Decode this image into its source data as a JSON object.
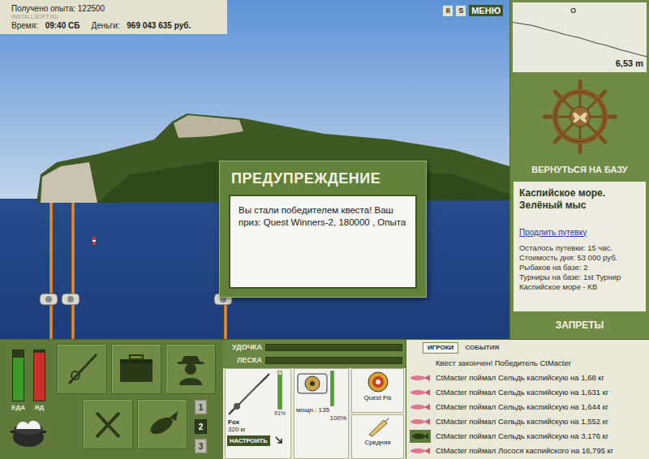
{
  "stats": {
    "experience_label": "Получено опыта:",
    "experience": "122500",
    "time_label": "Время:",
    "time": "09:40 СБ",
    "money_label": "Деньги:",
    "money": "969 043 635 руб."
  },
  "watermark": "INSTALLSOFT.RU",
  "top_buttons": [
    "II",
    "S",
    "МЕНЮ"
  ],
  "depth": {
    "reading": "6,53 m",
    "boat_position": 0.45,
    "profile": [
      1.2,
      1.4,
      1.6,
      1.9,
      2.3,
      2.6,
      3.0,
      3.3,
      3.6,
      4.0,
      4.4,
      4.7,
      5.1,
      5.5,
      5.8,
      6.2,
      6.5
    ]
  },
  "return_button": "ВЕРНУТЬСЯ НА БАЗУ",
  "location": {
    "title": "Каспийское море. Зелёный мыс",
    "extend_link": "Продлить путевку",
    "lines": [
      "Осталось путевки: 15 час.",
      "Стоимость дня: 53 000 руб.",
      "Рыбаков на базе: 2",
      "Турниры на базе: 1st Турнир Каспийское море - КВ"
    ]
  },
  "bans_button": "ЗАПРЕТЫ",
  "dialog": {
    "title": "ПРЕДУПРЕЖДЕНИЕ",
    "message": "Вы стали победителем квеста! Ваш приз: Quest Winners-2, 180000 , Опыта"
  },
  "needs": [
    {
      "label": "ЕДА",
      "level": 0.85,
      "color": "#3f9a2c"
    },
    {
      "label": "ЯД",
      "level": 0.95,
      "color": "#c8302a"
    }
  ],
  "rod_slots": [
    {
      "label": "1",
      "selected": false
    },
    {
      "label": "2",
      "selected": true
    },
    {
      "label": "3",
      "selected": false
    }
  ],
  "tension": [
    {
      "label": "УДОЧКА",
      "level": 0
    },
    {
      "label": "ЛЕСКА",
      "level": 0
    }
  ],
  "tackle": {
    "rod_name": "Fox",
    "rod_capacity": "320 кг",
    "rod_level": 0.91,
    "rod_reading": "91%",
    "reel_power": "мощн.: 135",
    "reel_level": 1.0,
    "reel_reading": "100%",
    "line": "Quest Fis",
    "lure": "Средняя"
  },
  "setup_button": "НАСТРОИТЬ",
  "log_tabs": [
    {
      "label": "ИГРОКИ",
      "selected": true
    },
    {
      "label": "СОБЫТИЯ",
      "selected": false
    }
  ],
  "log": [
    {
      "kind": "notice",
      "text": "Квест закончен! Победитель CtMacter"
    },
    {
      "kind": "catch",
      "text": "CtMacter поймал Сельдь каспийскую на 1,68 кг"
    },
    {
      "kind": "catch",
      "text": "CtMacter поймал Сельдь каспийскую на 1,631 кг"
    },
    {
      "kind": "catch",
      "text": "CtMacter поймал Сельдь каспийскую на 1,644 кг"
    },
    {
      "kind": "catch",
      "text": "CtMacter поймал Сельдь каспийскую на 1,552 кг"
    },
    {
      "kind": "trophy",
      "text": "CtMacter поймал Сельдь каспийскую на 3,176 кг"
    },
    {
      "kind": "catch",
      "text": "CtMacter поймал Лосося каспийского на 16,795 кг"
    }
  ]
}
